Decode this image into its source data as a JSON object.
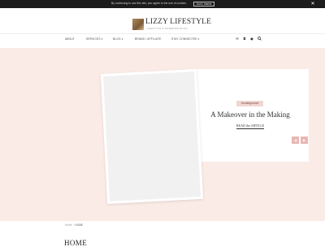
{
  "cookie_bar": {
    "message": "By continuing to use this site, you agree to the use of cookies.",
    "accept_label": "Got it, thanks",
    "close_icon": "close-icon"
  },
  "header": {
    "title": "LIZZY LIFESTYLE",
    "tagline": "LIFESTYLE & FREEDOM BLOG"
  },
  "nav": {
    "items": [
      {
        "label": "ABOUT"
      },
      {
        "label": "SERVICES ▾"
      },
      {
        "label": "BLOG ▾"
      },
      {
        "label": "BRAND / AFFILIATE"
      },
      {
        "label": "STAY CONNECTED ▾"
      }
    ],
    "icons": [
      "email-icon",
      "instagram-icon",
      "pinterest-icon",
      "search-icon"
    ]
  },
  "hero": {
    "category": "Uncategorized",
    "post_title": "A Makeover in the Making",
    "read_more": "READ the ARTICLE",
    "prev_icon": "arrow-left-icon",
    "next_icon": "arrow-right-icon"
  },
  "breadcrumb": {
    "home": "Home",
    "separator": "/",
    "current": "HOME"
  },
  "page": {
    "title": "HOME"
  },
  "colors": {
    "hero_background": "#fbebe6",
    "accent_pink": "#e8b8b3",
    "badge_background": "#f1d6d2",
    "cookie_bar": "#1c1c1c"
  }
}
